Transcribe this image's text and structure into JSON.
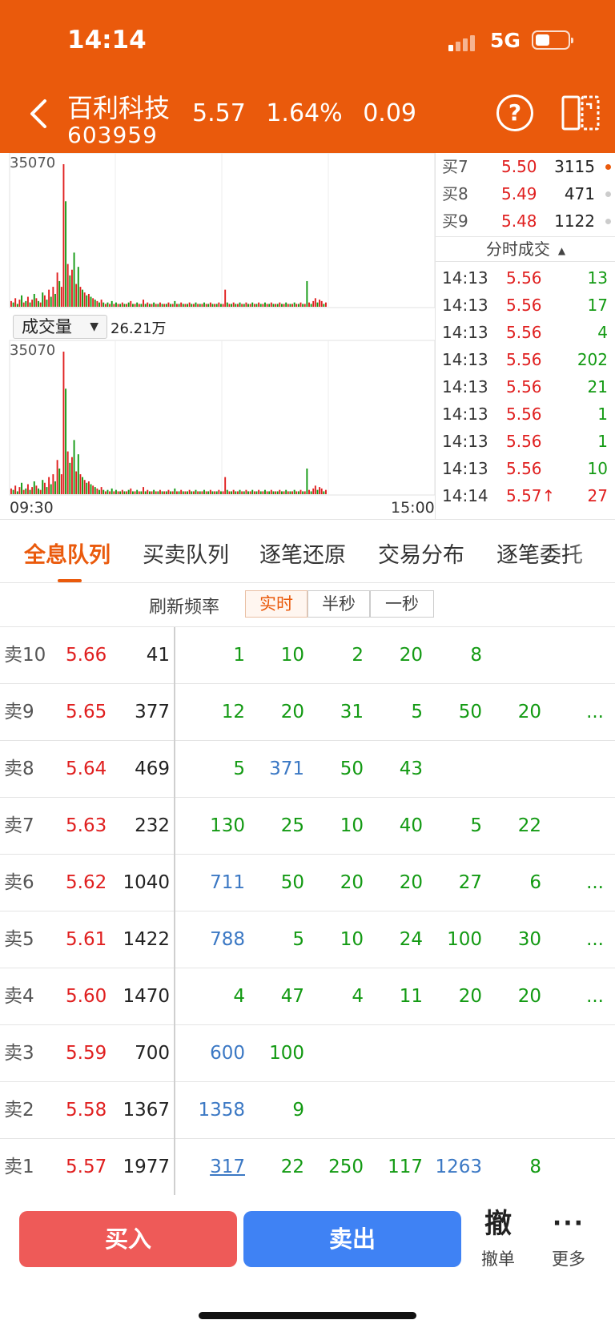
{
  "colors": {
    "header": "#ea5a0c",
    "up": "#e02020",
    "down": "#139a13",
    "blue": "#3b78c4",
    "accent": "#ea5a0c"
  },
  "status_bar": {
    "time": "14:14",
    "network": "5G"
  },
  "header": {
    "name": "百利科技",
    "code": "603959",
    "price": "5.57",
    "change_pct": "1.64%",
    "change": "0.09",
    "back_icon": "chevron-left-icon",
    "help_icon": "question-circle-icon",
    "switch_icon": "landscape-switch-icon"
  },
  "chart": {
    "upper_max_label": "35070",
    "lower_max_label": "35070",
    "indicator": "成交量",
    "indicator_total": "26.21万",
    "x_start": "09:30",
    "x_end": "15:00",
    "volume_series": [
      {
        "v": 4,
        "d": "up"
      },
      {
        "v": 3,
        "d": "down"
      },
      {
        "v": 6,
        "d": "up"
      },
      {
        "v": 2,
        "d": "down"
      },
      {
        "v": 5,
        "d": "up"
      },
      {
        "v": 8,
        "d": "down"
      },
      {
        "v": 3,
        "d": "up"
      },
      {
        "v": 4,
        "d": "down"
      },
      {
        "v": 7,
        "d": "up"
      },
      {
        "v": 3,
        "d": "down"
      },
      {
        "v": 5,
        "d": "up"
      },
      {
        "v": 9,
        "d": "down"
      },
      {
        "v": 6,
        "d": "up"
      },
      {
        "v": 4,
        "d": "down"
      },
      {
        "v": 3,
        "d": "up"
      },
      {
        "v": 10,
        "d": "down"
      },
      {
        "v": 8,
        "d": "up"
      },
      {
        "v": 5,
        "d": "down"
      },
      {
        "v": 12,
        "d": "up"
      },
      {
        "v": 7,
        "d": "down"
      },
      {
        "v": 14,
        "d": "up"
      },
      {
        "v": 9,
        "d": "down"
      },
      {
        "v": 24,
        "d": "up"
      },
      {
        "v": 18,
        "d": "down"
      },
      {
        "v": 14,
        "d": "up"
      },
      {
        "v": 100,
        "d": "up"
      },
      {
        "v": 74,
        "d": "down"
      },
      {
        "v": 30,
        "d": "up"
      },
      {
        "v": 22,
        "d": "down"
      },
      {
        "v": 26,
        "d": "up"
      },
      {
        "v": 38,
        "d": "down"
      },
      {
        "v": 16,
        "d": "up"
      },
      {
        "v": 28,
        "d": "down"
      },
      {
        "v": 14,
        "d": "up"
      },
      {
        "v": 12,
        "d": "down"
      },
      {
        "v": 10,
        "d": "up"
      },
      {
        "v": 8,
        "d": "down"
      },
      {
        "v": 9,
        "d": "up"
      },
      {
        "v": 7,
        "d": "down"
      },
      {
        "v": 6,
        "d": "up"
      },
      {
        "v": 5,
        "d": "down"
      },
      {
        "v": 4,
        "d": "up"
      },
      {
        "v": 3,
        "d": "down"
      },
      {
        "v": 5,
        "d": "up"
      },
      {
        "v": 3,
        "d": "down"
      },
      {
        "v": 2,
        "d": "up"
      },
      {
        "v": 3,
        "d": "down"
      },
      {
        "v": 2,
        "d": "up"
      },
      {
        "v": 4,
        "d": "down"
      },
      {
        "v": 2,
        "d": "up"
      },
      {
        "v": 3,
        "d": "down"
      },
      {
        "v": 2,
        "d": "up"
      },
      {
        "v": 2,
        "d": "down"
      },
      {
        "v": 3,
        "d": "up"
      },
      {
        "v": 2,
        "d": "down"
      },
      {
        "v": 2,
        "d": "up"
      },
      {
        "v": 3,
        "d": "down"
      },
      {
        "v": 4,
        "d": "up"
      },
      {
        "v": 2,
        "d": "down"
      },
      {
        "v": 2,
        "d": "up"
      },
      {
        "v": 3,
        "d": "down"
      },
      {
        "v": 2,
        "d": "up"
      },
      {
        "v": 2,
        "d": "down"
      },
      {
        "v": 5,
        "d": "up"
      },
      {
        "v": 2,
        "d": "down"
      },
      {
        "v": 3,
        "d": "up"
      },
      {
        "v": 2,
        "d": "down"
      },
      {
        "v": 2,
        "d": "up"
      },
      {
        "v": 3,
        "d": "down"
      },
      {
        "v": 2,
        "d": "up"
      },
      {
        "v": 2,
        "d": "down"
      },
      {
        "v": 3,
        "d": "up"
      },
      {
        "v": 2,
        "d": "down"
      },
      {
        "v": 2,
        "d": "up"
      },
      {
        "v": 2,
        "d": "down"
      },
      {
        "v": 3,
        "d": "up"
      },
      {
        "v": 2,
        "d": "down"
      },
      {
        "v": 2,
        "d": "up"
      },
      {
        "v": 4,
        "d": "down"
      },
      {
        "v": 2,
        "d": "up"
      },
      {
        "v": 2,
        "d": "down"
      },
      {
        "v": 3,
        "d": "up"
      },
      {
        "v": 2,
        "d": "down"
      },
      {
        "v": 2,
        "d": "up"
      },
      {
        "v": 2,
        "d": "down"
      },
      {
        "v": 3,
        "d": "up"
      },
      {
        "v": 2,
        "d": "down"
      },
      {
        "v": 2,
        "d": "up"
      },
      {
        "v": 3,
        "d": "down"
      },
      {
        "v": 2,
        "d": "up"
      },
      {
        "v": 2,
        "d": "down"
      },
      {
        "v": 2,
        "d": "up"
      },
      {
        "v": 3,
        "d": "down"
      },
      {
        "v": 2,
        "d": "up"
      },
      {
        "v": 2,
        "d": "down"
      },
      {
        "v": 3,
        "d": "up"
      },
      {
        "v": 2,
        "d": "down"
      },
      {
        "v": 2,
        "d": "up"
      },
      {
        "v": 2,
        "d": "down"
      },
      {
        "v": 3,
        "d": "up"
      },
      {
        "v": 2,
        "d": "down"
      },
      {
        "v": 2,
        "d": "up"
      },
      {
        "v": 12,
        "d": "up"
      },
      {
        "v": 3,
        "d": "down"
      },
      {
        "v": 2,
        "d": "up"
      },
      {
        "v": 2,
        "d": "down"
      },
      {
        "v": 3,
        "d": "up"
      },
      {
        "v": 2,
        "d": "down"
      },
      {
        "v": 2,
        "d": "up"
      },
      {
        "v": 3,
        "d": "down"
      },
      {
        "v": 2,
        "d": "up"
      },
      {
        "v": 2,
        "d": "down"
      },
      {
        "v": 3,
        "d": "up"
      },
      {
        "v": 2,
        "d": "down"
      },
      {
        "v": 2,
        "d": "up"
      },
      {
        "v": 3,
        "d": "down"
      },
      {
        "v": 2,
        "d": "up"
      },
      {
        "v": 2,
        "d": "down"
      },
      {
        "v": 3,
        "d": "up"
      },
      {
        "v": 2,
        "d": "down"
      },
      {
        "v": 2,
        "d": "up"
      },
      {
        "v": 3,
        "d": "down"
      },
      {
        "v": 2,
        "d": "up"
      },
      {
        "v": 2,
        "d": "down"
      },
      {
        "v": 3,
        "d": "up"
      },
      {
        "v": 2,
        "d": "down"
      },
      {
        "v": 2,
        "d": "up"
      },
      {
        "v": 2,
        "d": "down"
      },
      {
        "v": 3,
        "d": "up"
      },
      {
        "v": 2,
        "d": "down"
      },
      {
        "v": 2,
        "d": "up"
      },
      {
        "v": 3,
        "d": "down"
      },
      {
        "v": 2,
        "d": "up"
      },
      {
        "v": 2,
        "d": "down"
      },
      {
        "v": 2,
        "d": "up"
      },
      {
        "v": 3,
        "d": "down"
      },
      {
        "v": 2,
        "d": "up"
      },
      {
        "v": 2,
        "d": "down"
      },
      {
        "v": 3,
        "d": "up"
      },
      {
        "v": 2,
        "d": "down"
      },
      {
        "v": 2,
        "d": "up"
      },
      {
        "v": 18,
        "d": "down"
      },
      {
        "v": 3,
        "d": "up"
      },
      {
        "v": 2,
        "d": "down"
      },
      {
        "v": 4,
        "d": "up"
      },
      {
        "v": 6,
        "d": "up"
      },
      {
        "v": 3,
        "d": "down"
      },
      {
        "v": 5,
        "d": "up"
      },
      {
        "v": 4,
        "d": "up"
      },
      {
        "v": 2,
        "d": "down"
      },
      {
        "v": 3,
        "d": "up"
      }
    ]
  },
  "ask_levels": [
    {
      "label": "买7",
      "price": "5.50",
      "volume": "3115",
      "dot": "orange"
    },
    {
      "label": "买8",
      "price": "5.49",
      "volume": "471",
      "dot": "grey"
    },
    {
      "label": "买9",
      "price": "5.48",
      "volume": "1122",
      "dot": "grey"
    }
  ],
  "ticks": {
    "title": "分时成交",
    "rows": [
      {
        "time": "14:13",
        "price": "5.56",
        "volume": "13",
        "dir": "down"
      },
      {
        "time": "14:13",
        "price": "5.56",
        "volume": "17",
        "dir": "down"
      },
      {
        "time": "14:13",
        "price": "5.56",
        "volume": "4",
        "dir": "down"
      },
      {
        "time": "14:13",
        "price": "5.56",
        "volume": "202",
        "dir": "down"
      },
      {
        "time": "14:13",
        "price": "5.56",
        "volume": "21",
        "dir": "down"
      },
      {
        "time": "14:13",
        "price": "5.56",
        "volume": "1",
        "dir": "down"
      },
      {
        "time": "14:13",
        "price": "5.56",
        "volume": "1",
        "dir": "down"
      },
      {
        "time": "14:13",
        "price": "5.56",
        "volume": "10",
        "dir": "down"
      },
      {
        "time": "14:14",
        "price": "5.57↑",
        "volume": "27",
        "dir": "up"
      }
    ]
  },
  "tabs": [
    {
      "label": "全息队列",
      "active": true
    },
    {
      "label": "买卖队列",
      "active": false
    },
    {
      "label": "逐笔还原",
      "active": false
    },
    {
      "label": "交易分布",
      "active": false
    },
    {
      "label": "逐笔委托",
      "active": false
    }
  ],
  "refresh": {
    "label": "刷新频率",
    "options": [
      {
        "label": "实时",
        "active": true
      },
      {
        "label": "半秒",
        "active": false
      },
      {
        "label": "一秒",
        "active": false
      }
    ]
  },
  "queue": {
    "more_marker": "...",
    "rows": [
      {
        "label": "卖10",
        "price": "5.66",
        "total": "41",
        "orders": [
          {
            "v": "1",
            "c": "g"
          },
          {
            "v": "10",
            "c": "g"
          },
          {
            "v": "2",
            "c": "g"
          },
          {
            "v": "20",
            "c": "g"
          },
          {
            "v": "8",
            "c": "g"
          }
        ],
        "more": false
      },
      {
        "label": "卖9",
        "price": "5.65",
        "total": "377",
        "orders": [
          {
            "v": "12",
            "c": "g"
          },
          {
            "v": "20",
            "c": "g"
          },
          {
            "v": "31",
            "c": "g"
          },
          {
            "v": "5",
            "c": "g"
          },
          {
            "v": "50",
            "c": "g"
          },
          {
            "v": "20",
            "c": "g"
          }
        ],
        "more": true
      },
      {
        "label": "卖8",
        "price": "5.64",
        "total": "469",
        "orders": [
          {
            "v": "5",
            "c": "g"
          },
          {
            "v": "371",
            "c": "b"
          },
          {
            "v": "50",
            "c": "g"
          },
          {
            "v": "43",
            "c": "g"
          }
        ],
        "more": false
      },
      {
        "label": "卖7",
        "price": "5.63",
        "total": "232",
        "orders": [
          {
            "v": "130",
            "c": "g"
          },
          {
            "v": "25",
            "c": "g"
          },
          {
            "v": "10",
            "c": "g"
          },
          {
            "v": "40",
            "c": "g"
          },
          {
            "v": "5",
            "c": "g"
          },
          {
            "v": "22",
            "c": "g"
          }
        ],
        "more": false
      },
      {
        "label": "卖6",
        "price": "5.62",
        "total": "1040",
        "orders": [
          {
            "v": "711",
            "c": "b"
          },
          {
            "v": "50",
            "c": "g"
          },
          {
            "v": "20",
            "c": "g"
          },
          {
            "v": "20",
            "c": "g"
          },
          {
            "v": "27",
            "c": "g"
          },
          {
            "v": "6",
            "c": "g"
          }
        ],
        "more": true
      },
      {
        "label": "卖5",
        "price": "5.61",
        "total": "1422",
        "orders": [
          {
            "v": "788",
            "c": "b"
          },
          {
            "v": "5",
            "c": "g"
          },
          {
            "v": "10",
            "c": "g"
          },
          {
            "v": "24",
            "c": "g"
          },
          {
            "v": "100",
            "c": "g"
          },
          {
            "v": "30",
            "c": "g"
          }
        ],
        "more": true
      },
      {
        "label": "卖4",
        "price": "5.60",
        "total": "1470",
        "orders": [
          {
            "v": "4",
            "c": "g"
          },
          {
            "v": "47",
            "c": "g"
          },
          {
            "v": "4",
            "c": "g"
          },
          {
            "v": "11",
            "c": "g"
          },
          {
            "v": "20",
            "c": "g"
          },
          {
            "v": "20",
            "c": "g"
          }
        ],
        "more": true
      },
      {
        "label": "卖3",
        "price": "5.59",
        "total": "700",
        "orders": [
          {
            "v": "600",
            "c": "b"
          },
          {
            "v": "100",
            "c": "g"
          }
        ],
        "more": false
      },
      {
        "label": "卖2",
        "price": "5.58",
        "total": "1367",
        "orders": [
          {
            "v": "1358",
            "c": "b"
          },
          {
            "v": "9",
            "c": "g"
          }
        ],
        "more": false
      },
      {
        "label": "卖1",
        "price": "5.57",
        "total": "1977",
        "orders": [
          {
            "v": "317",
            "c": "b",
            "u": true
          },
          {
            "v": "22",
            "c": "g"
          },
          {
            "v": "250",
            "c": "g"
          },
          {
            "v": "117",
            "c": "g"
          },
          {
            "v": "1263",
            "c": "b"
          },
          {
            "v": "8",
            "c": "g"
          }
        ],
        "more": false
      }
    ]
  },
  "bottom": {
    "buy": "买入",
    "sell": "卖出",
    "cancel_icon": "撤",
    "cancel": "撤单",
    "more_icon": "···",
    "more": "更多"
  }
}
